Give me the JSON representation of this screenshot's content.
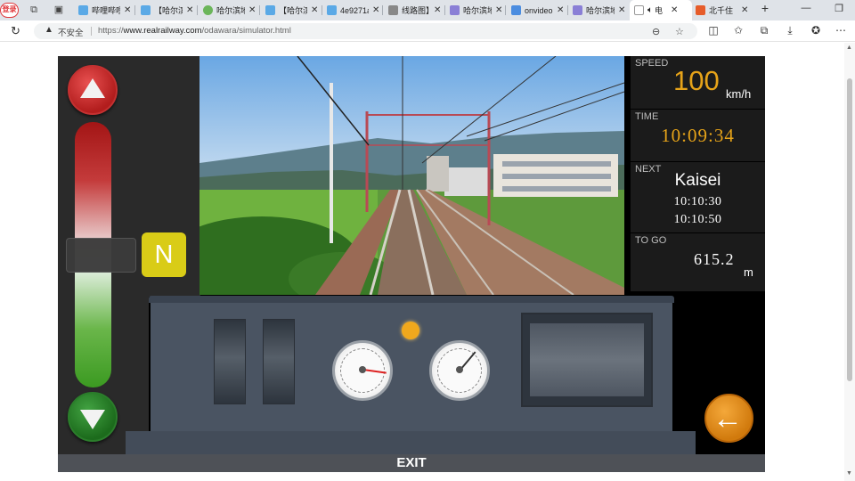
{
  "browser": {
    "login_label": "登录",
    "tabs": [
      {
        "label": "哔哩哔哩",
        "fav_color": "#5aa9e6"
      },
      {
        "label": "【哈尔滨",
        "fav_color": "#5aa9e6"
      },
      {
        "label": "哈尔滨地",
        "fav_color": "#6bb55a"
      },
      {
        "label": "【哈尔滨",
        "fav_color": "#5aa9e6"
      },
      {
        "label": "4e9271a",
        "fav_color": "#5aa9e6"
      },
      {
        "label": "线路图】",
        "fav_color": "#888888"
      },
      {
        "label": "哈尔滨地",
        "fav_color": "#8a7fd6"
      },
      {
        "label": "onvideo",
        "fav_color": "#4b8de0"
      },
      {
        "label": "哈尔滨地",
        "fav_color": "#8a7fd6"
      },
      {
        "label": "电",
        "fav_color": "#999999"
      },
      {
        "label": "北千住",
        "fav_color": "#e65c2a"
      }
    ],
    "security_label": "不安全",
    "url_prefix": "https://",
    "url_host": "www.realrailway.com",
    "url_path": "/odawara/simulator.html"
  },
  "simulator": {
    "notch": "N",
    "speed": {
      "label": "SPEED",
      "value": "100",
      "unit": "km/h"
    },
    "time": {
      "label": "TIME",
      "value": "10:09:34"
    },
    "next": {
      "label": "NEXT",
      "station": "Kaisei",
      "arrive": "10:10:30",
      "depart": "10:10:50"
    },
    "to_go": {
      "label": "TO GO",
      "value": "615.2",
      "unit": "m"
    },
    "exit_label": "EXIT",
    "accent_color": "#e6a319"
  }
}
